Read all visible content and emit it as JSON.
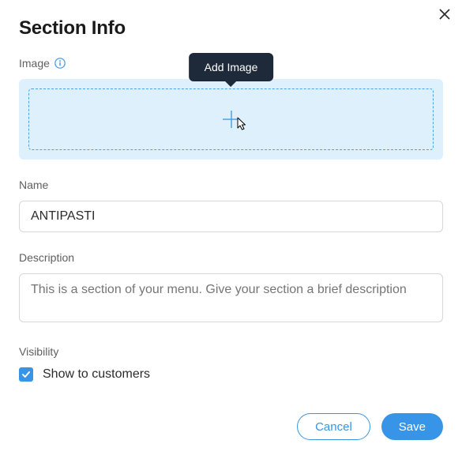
{
  "dialog": {
    "title": "Section Info",
    "tooltip": "Add Image",
    "labels": {
      "image": "Image",
      "name": "Name",
      "description": "Description",
      "visibility": "Visibility"
    },
    "fields": {
      "name_value": "ANTIPASTI",
      "description_placeholder": "This is a section of your menu. Give your section a brief description"
    },
    "visibility": {
      "show_to_customers_label": "Show to customers",
      "checked": true
    },
    "footer": {
      "cancel": "Cancel",
      "save": "Save"
    }
  }
}
